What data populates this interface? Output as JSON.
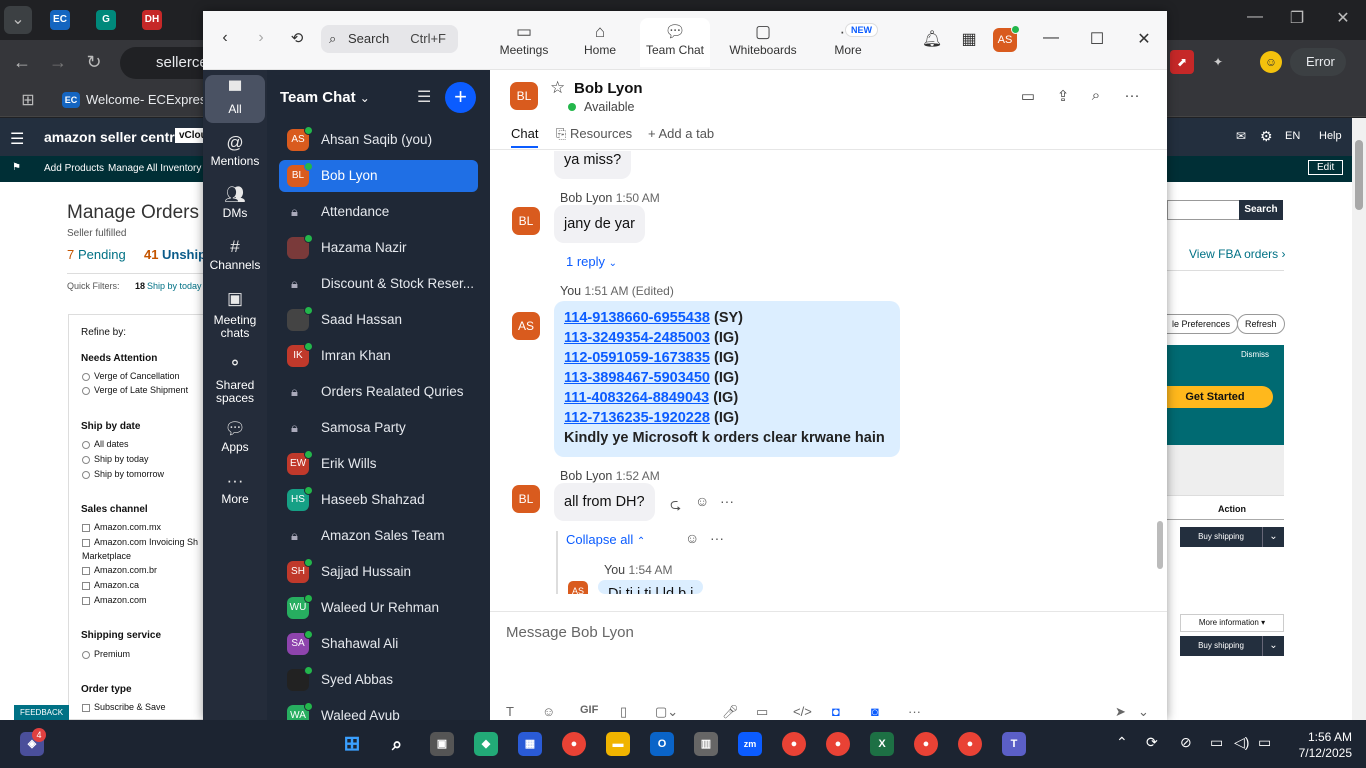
{
  "chrome": {
    "tab_icons": [
      "EC",
      "G",
      "DH"
    ],
    "omnibox": "sellerce",
    "bookmark": "Welcome- ECExpres",
    "error": "Error"
  },
  "amazon": {
    "logo": "amazon seller central",
    "vclou": "vClou",
    "lang": "EN",
    "help": "Help",
    "add_products": "Add Products",
    "manage_inventory": "Manage All Inventory",
    "edit": "Edit",
    "title": "Manage Orders",
    "seller_fulfilled": "Seller fulfilled",
    "pending_count": "7",
    "pending": "Pending",
    "unshipped_count": "41",
    "unshipped": "Unship",
    "quick_filters": "Quick Filters:",
    "ship_today_count": "18",
    "ship_today": "Ship by today",
    "search": "Search",
    "view_fba": "View FBA orders",
    "prefs": "le Preferences",
    "refresh": "Refresh",
    "dismiss": "Dismiss",
    "get_started": "Get Started",
    "action": "Action",
    "buy_shipping": "Buy shipping",
    "more_info": "More information",
    "refine": "Refine by:",
    "needs_attention": "Needs Attention",
    "verge_cancel": "Verge of Cancellation",
    "verge_late": "Verge of Late Shipment",
    "ship_by_date": "Ship by date",
    "all_dates": "All dates",
    "ship_today2": "Ship by today",
    "ship_tomorrow": "Ship by tomorrow",
    "sales_channel": "Sales channel",
    "ch_mx": "Amazon.com.mx",
    "ch_invoicing": "Amazon.com Invoicing Sh",
    "ch_marketplace": "Marketplace",
    "ch_br": "Amazon.com.br",
    "ch_ca": "Amazon.ca",
    "ch_com": "Amazon.com",
    "shipping_service": "Shipping service",
    "premium": "Premium",
    "order_type": "Order type",
    "subscribe": "Subscribe & Save",
    "feedback": "FEEDBACK"
  },
  "zoom": {
    "search_placeholder": "Search",
    "search_shortcut": "Ctrl+F",
    "nav": [
      {
        "label": "Meetings"
      },
      {
        "label": "Home"
      },
      {
        "label": "Team Chat"
      },
      {
        "label": "Whiteboards"
      },
      {
        "label": "More"
      }
    ],
    "new_badge": "NEW",
    "user_initials": "AS",
    "rail": [
      {
        "label": "All"
      },
      {
        "label": "Mentions"
      },
      {
        "label": "DMs"
      },
      {
        "label": "Channels"
      },
      {
        "label": "Meeting chats"
      },
      {
        "label": "Shared spaces"
      },
      {
        "label": "Apps"
      },
      {
        "label": "More"
      }
    ],
    "list_title": "Team Chat",
    "chats": [
      {
        "name": "Ahsan Saqib (you)",
        "initials": "AS",
        "color": "#d95b1e"
      },
      {
        "name": "Bob Lyon",
        "initials": "BL",
        "color": "#d95b1e"
      },
      {
        "name": "Attendance",
        "initials": "",
        "color": ""
      },
      {
        "name": "Hazama Nazir",
        "initials": "",
        "color": "#7a3a3a"
      },
      {
        "name": "Discount & Stock Reser...",
        "initials": "",
        "color": ""
      },
      {
        "name": "Saad Hassan",
        "initials": "",
        "color": "#444"
      },
      {
        "name": "Imran Khan",
        "initials": "IK",
        "color": "#c0392b"
      },
      {
        "name": "Orders Realated Quries",
        "initials": "",
        "color": ""
      },
      {
        "name": "Samosa Party",
        "initials": "",
        "color": ""
      },
      {
        "name": "Erik Wills",
        "initials": "EW",
        "color": "#c0392b"
      },
      {
        "name": "Haseeb Shahzad",
        "initials": "HS",
        "color": "#16a085"
      },
      {
        "name": "Amazon Sales Team",
        "initials": "",
        "color": ""
      },
      {
        "name": "Sajjad Hussain",
        "initials": "SH",
        "color": "#c0392b"
      },
      {
        "name": "Waleed Ur Rehman",
        "initials": "WU",
        "color": "#27ae60"
      },
      {
        "name": "Shahawal Ali",
        "initials": "SA",
        "color": "#8e44ad"
      },
      {
        "name": "Syed Abbas",
        "initials": "",
        "color": "#222"
      },
      {
        "name": "Waleed Ayub",
        "initials": "WA",
        "color": "#27ae60"
      }
    ],
    "conversation": {
      "name": "Bob Lyon",
      "initials": "BL",
      "status": "Available",
      "tabs": [
        "Chat",
        "Resources",
        "Add a tab"
      ],
      "msg_ya_miss": "ya miss?",
      "bob_meta1_name": "Bob Lyon",
      "bob_meta1_time": "1:50 AM",
      "msg_jany": "jany de yar",
      "reply_link": "1 reply",
      "you_meta_name": "You",
      "you_meta_time": "1:51 AM (Edited)",
      "orders": [
        {
          "id": "114-9138660-6955438",
          "tag": "(SY)"
        },
        {
          "id": "113-3249354-2485003",
          "tag": "(IG)"
        },
        {
          "id": "112-0591059-1673835",
          "tag": "(IG)"
        },
        {
          "id": "113-3898467-5903450",
          "tag": "(IG)"
        },
        {
          "id": "111-4083264-8849043",
          "tag": "(IG)"
        },
        {
          "id": "112-7136235-1920228",
          "tag": "(IG)"
        }
      ],
      "orders_note": "Kindly ye Microsoft k orders clear krwane hain",
      "bob_meta2_name": "Bob Lyon",
      "bob_meta2_time": "1:52 AM",
      "msg_all_from": "all from DH?",
      "collapse": "Collapse all",
      "you_meta2_name": "You",
      "you_meta2_time": "1:54 AM",
      "msg_partial": "Di ti  i ti  l  ld b i",
      "compose_placeholder": "Message Bob Lyon"
    }
  },
  "taskbar": {
    "notif_count": "4",
    "time": "1:56 AM",
    "date": "7/12/2025"
  }
}
